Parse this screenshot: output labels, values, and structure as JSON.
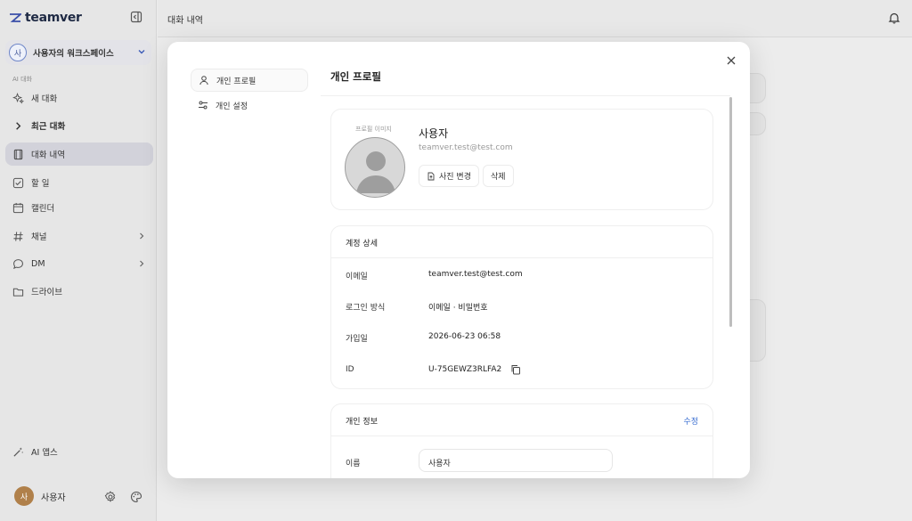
{
  "sidebar": {
    "brand": "teamver",
    "workspace": {
      "avatar": "사",
      "name": "사용자의 워크스페이스"
    },
    "section_label": "AI 대화",
    "items": [
      {
        "label": "새 대화",
        "icon": "sparkle-icon"
      },
      {
        "label": "최근 대화",
        "icon": "chevron-right-icon"
      },
      {
        "label": "대화 내역",
        "icon": "notebook-icon"
      },
      {
        "label": "할 일",
        "icon": "checkbox-icon"
      },
      {
        "label": "캘린더",
        "icon": "calendar-icon"
      },
      {
        "label": "채널",
        "icon": "hash-icon"
      },
      {
        "label": "DM",
        "icon": "chat-bubble-icon"
      },
      {
        "label": "드라이브",
        "icon": "folder-icon"
      },
      {
        "label": "AI 앱스",
        "icon": "magic-wand-icon"
      }
    ],
    "user": {
      "avatar": "사",
      "name": "사용자"
    }
  },
  "header": {
    "title": "대화 내역"
  },
  "modal": {
    "nav": [
      {
        "label": "개인 프로필",
        "icon": "user-icon"
      },
      {
        "label": "개인 설정",
        "icon": "sliders-icon"
      }
    ],
    "title": "개인 프로필",
    "profile": {
      "avatar_label": "프로필 이미지",
      "name": "사용자",
      "email": "teamver.test@test.com",
      "change_photo": "사진 변경",
      "delete": "삭제"
    },
    "account": {
      "title": "계정 상세",
      "rows": [
        {
          "label": "이메일",
          "value": "teamver.test@test.com"
        },
        {
          "label": "로그인 방식",
          "value": "이메일 · 비밀번호"
        },
        {
          "label": "가입일",
          "value": "2026-06-23 06:58"
        },
        {
          "label": "ID",
          "value": "U-75GEWZ3RLFA2"
        }
      ]
    },
    "personal": {
      "title": "개인 정보",
      "edit": "수정",
      "name_label": "이름",
      "name_value": "사용자"
    }
  },
  "colors": {
    "accent": "#3b6fd1",
    "active_nav": "#d2d2da",
    "brand": "#1f2a44"
  }
}
